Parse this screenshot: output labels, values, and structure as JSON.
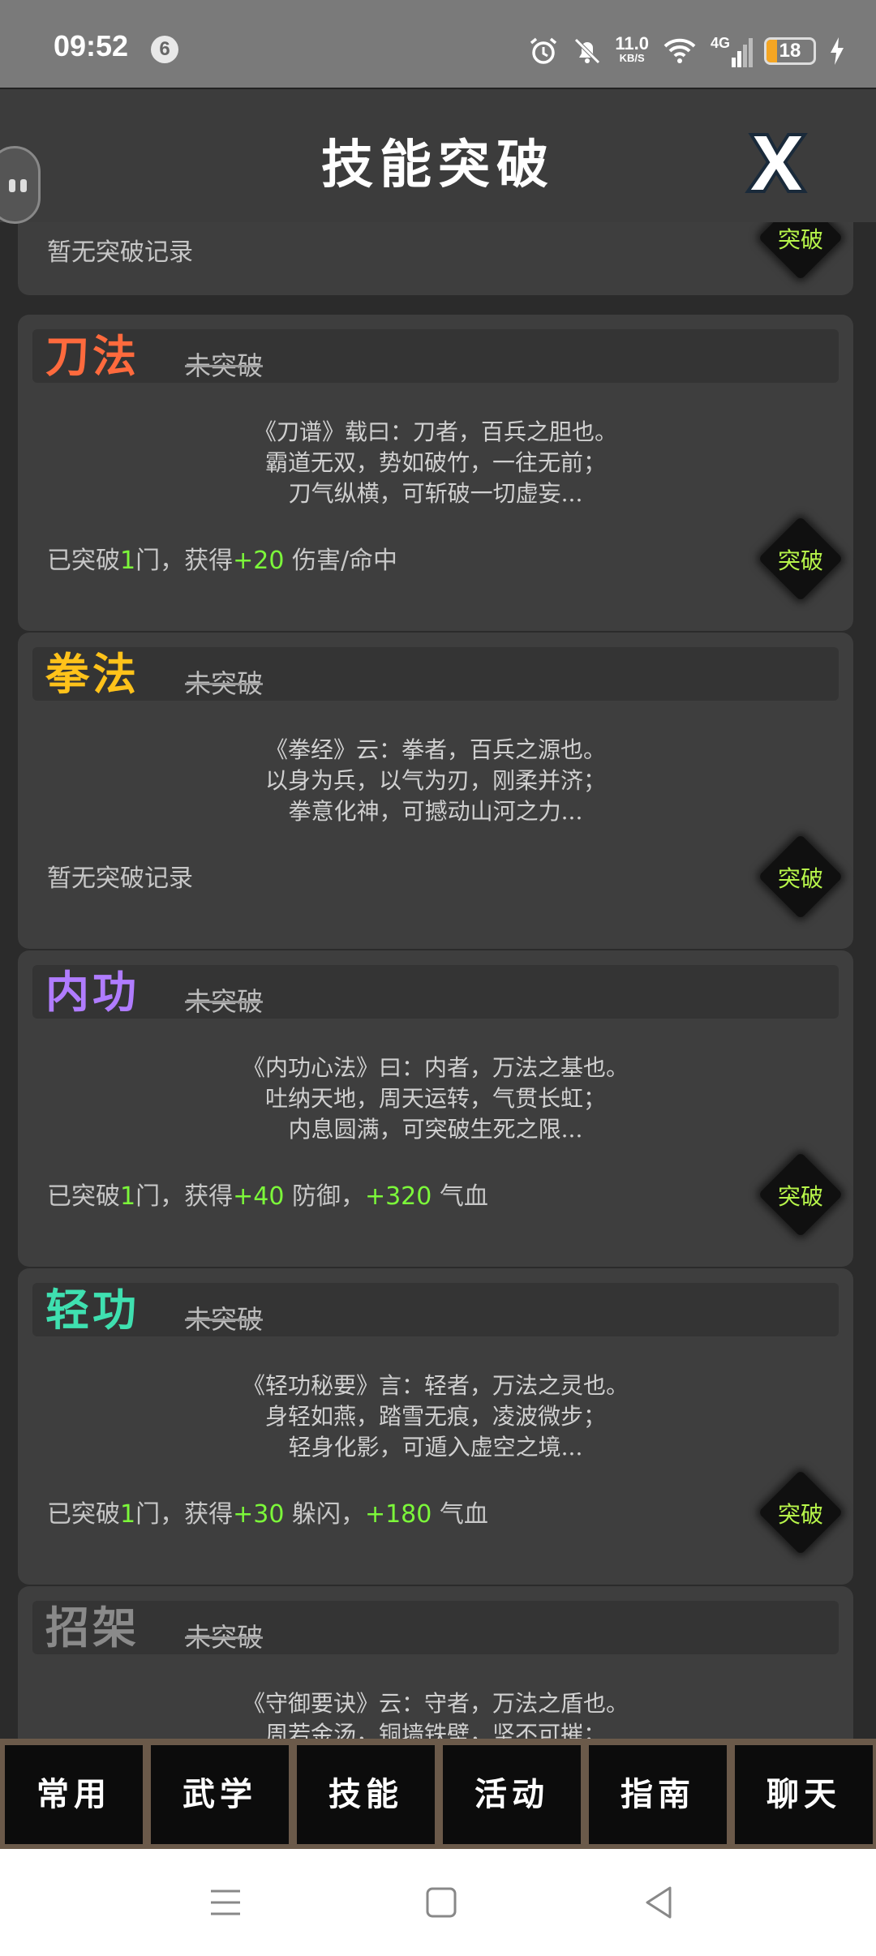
{
  "status_bar": {
    "time": "09:52",
    "notif_count": "6",
    "speed_value": "11.0",
    "speed_unit": "KB/S",
    "network": "4G",
    "battery": "18"
  },
  "header": {
    "title": "技能突破"
  },
  "top_partial": {
    "result": "暂无突破记录",
    "button": "突破"
  },
  "cards": [
    {
      "name": "刀法",
      "name_color": "#ff6a3d",
      "status": "未突破",
      "quote": [
        "《刀谱》载曰：刀者，百兵之胆也。",
        "霸道无双，势如破竹，一往无前；",
        "刀气纵横，可斩破一切虚妄..."
      ],
      "result": [
        {
          "t": "已突破",
          "g": false
        },
        {
          "t": "1",
          "g": true
        },
        {
          "t": "门，获得",
          "g": false
        },
        {
          "t": "+20",
          "g": true
        },
        {
          "t": " 伤害/命中",
          "g": false
        }
      ],
      "button": "突破"
    },
    {
      "name": "拳法",
      "name_color": "#ffc21a",
      "status": "未突破",
      "quote": [
        "《拳经》云：拳者，百兵之源也。",
        "以身为兵，以气为刃，刚柔并济；",
        "拳意化神，可撼动山河之力..."
      ],
      "result": [
        {
          "t": "暂无突破记录",
          "g": false
        }
      ],
      "button": "突破"
    },
    {
      "name": "内功",
      "name_color": "#b07cff",
      "status": "未突破",
      "quote": [
        "《内功心法》曰：内者，万法之基也。",
        "吐纳天地，周天运转，气贯长虹；",
        "内息圆满，可突破生死之限..."
      ],
      "result": [
        {
          "t": "已突破",
          "g": false
        },
        {
          "t": "1",
          "g": true
        },
        {
          "t": "门，获得",
          "g": false
        },
        {
          "t": "+40",
          "g": true
        },
        {
          "t": " 防御，",
          "g": false
        },
        {
          "t": "+320",
          "g": true
        },
        {
          "t": " 气血",
          "g": false
        }
      ],
      "button": "突破"
    },
    {
      "name": "轻功",
      "name_color": "#3fe0b0",
      "status": "未突破",
      "quote": [
        "《轻功秘要》言：轻者，万法之灵也。",
        "身轻如燕，踏雪无痕，凌波微步；",
        "轻身化影，可遁入虚空之境..."
      ],
      "result": [
        {
          "t": "已突破",
          "g": false
        },
        {
          "t": "1",
          "g": true
        },
        {
          "t": "门，获得",
          "g": false
        },
        {
          "t": "+30",
          "g": true
        },
        {
          "t": " 躲闪，",
          "g": false
        },
        {
          "t": "+180",
          "g": true
        },
        {
          "t": " 气血",
          "g": false
        }
      ],
      "button": "突破"
    },
    {
      "name": "招架",
      "name_color": "#8a8a8a",
      "status": "未突破",
      "quote": [
        "《守御要诀》云：守者，万法之盾也。",
        "周若金汤，铜墙铁壁，坚不可摧；"
      ],
      "result": [],
      "button": ""
    }
  ],
  "tabs": [
    "常用",
    "武学",
    "技能",
    "活动",
    "指南",
    "聊天"
  ],
  "icons": [
    "alarm-icon",
    "bell-off-icon",
    "wifi-icon",
    "signal-icon",
    "battery-icon",
    "charging-icon",
    "close-icon",
    "menu-icon",
    "home-icon",
    "back-icon"
  ]
}
